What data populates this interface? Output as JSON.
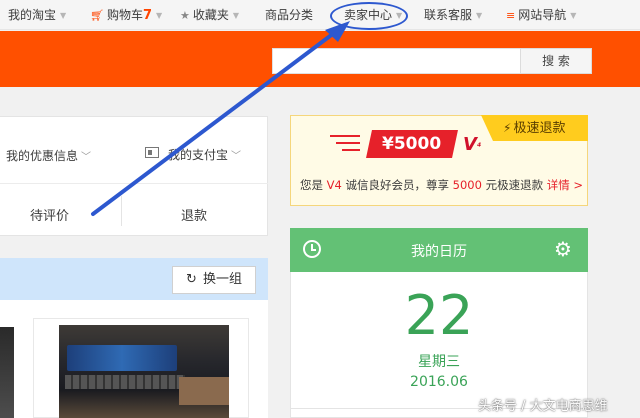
{
  "topnav": {
    "my_taobao": "我的淘宝",
    "cart_label": "购物车",
    "cart_count": "7",
    "favorites": "收藏夹",
    "categories": "商品分类",
    "seller_center": "卖家中心",
    "customer_service": "联系客服",
    "site_nav": "网站导航"
  },
  "search": {
    "button_label": "搜 索",
    "placeholder": ""
  },
  "account": {
    "coupon_label": "我的优惠信息",
    "alipay_label": "我的支付宝",
    "tab_review": "待评价",
    "tab_refund": "退款"
  },
  "recommend": {
    "refresh_label": "换一组"
  },
  "refund_promo": {
    "amount": "¥5000",
    "logo_text": "V",
    "tag_label": "极速退款",
    "desc_prefix": "您是",
    "level": "V4",
    "desc_mid": "诚信良好会员，尊享",
    "limit": "5000",
    "desc_suffix": "元极速退款",
    "detail_link": "详情 >"
  },
  "calendar": {
    "title": "我的日历",
    "day": "22",
    "weekday": "星期三",
    "month": "2016.06"
  },
  "watermark": "头条号 / 大文电商思维",
  "colors": {
    "brand_orange": "#ff5000",
    "calendar_green": "#63c175",
    "annotation_blue": "#2d58cf",
    "promo_red": "#e6212a"
  }
}
